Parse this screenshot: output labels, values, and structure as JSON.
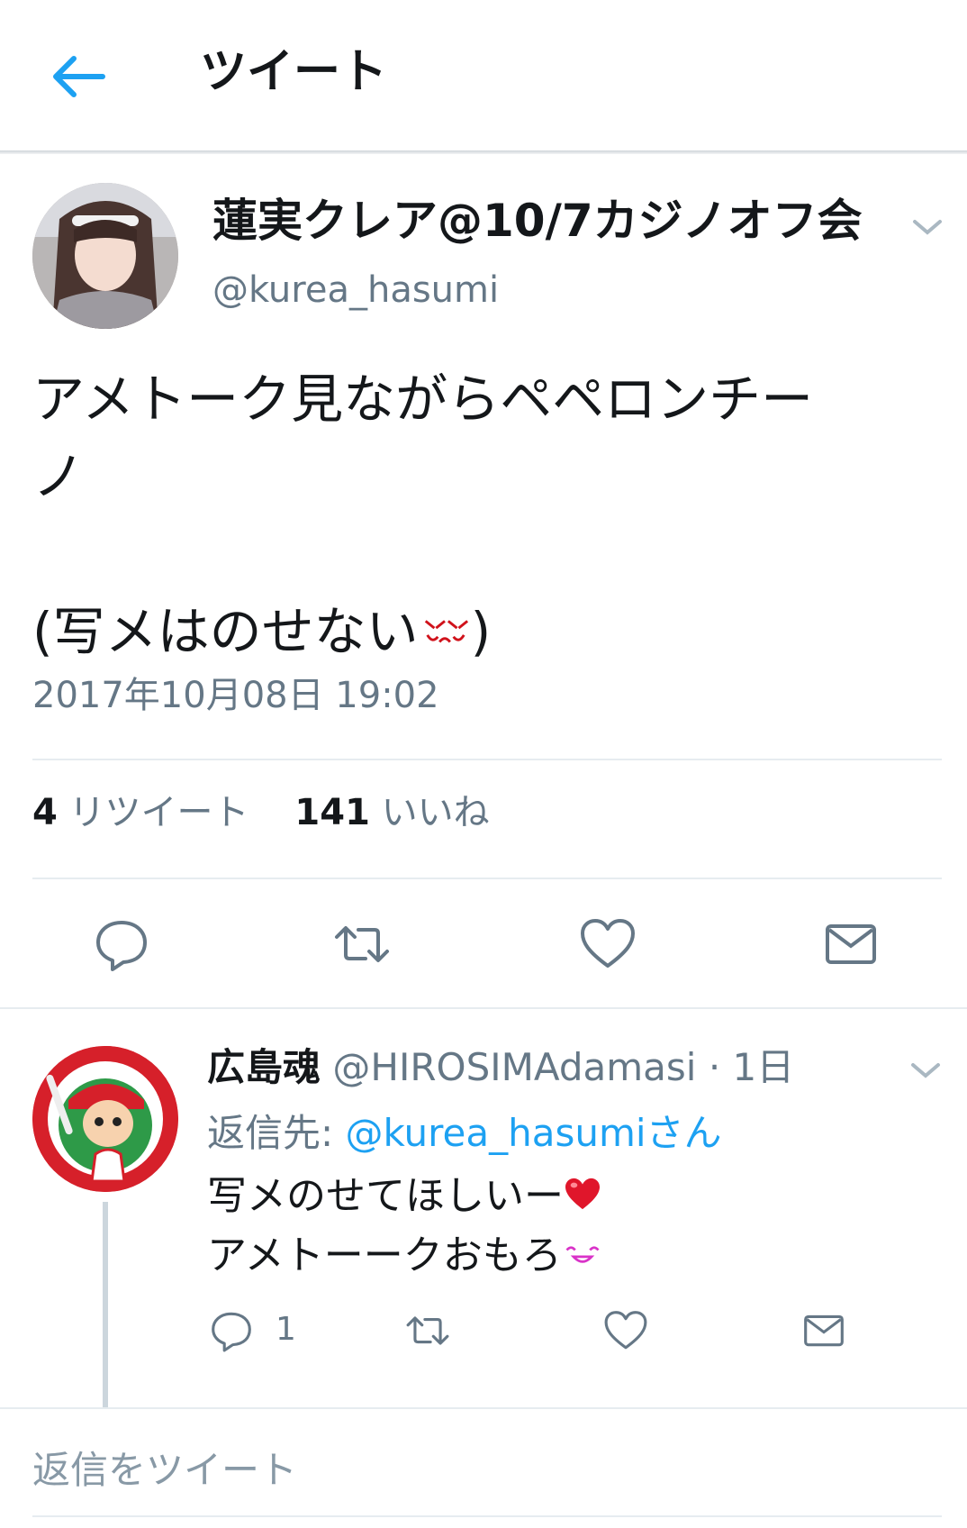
{
  "header": {
    "title": "ツイート"
  },
  "tweet": {
    "display_name": "蓮実クレア@10/7カジノオフ会",
    "handle": "@kurea_hasumi",
    "text_line1": "アメトーク見ながらペペロンチー",
    "text_line2": "ノ",
    "text_line3": "(写メはのせない",
    "text_line3_close": ")",
    "timestamp": "2017年10月08日 19:02",
    "retweet_count": "4",
    "retweet_label": "リツイート",
    "like_count": "141",
    "like_label": "いいね"
  },
  "reply": {
    "display_name": "広島魂",
    "handle": "@HIROSIMAdamasi",
    "time": "· 1日",
    "reply_to_label": "返信先: ",
    "reply_to_handle": "@kurea_hasumiさん",
    "text_line1": "写メのせてほしいー",
    "text_line2": "アメトーークおもろ",
    "reply_count": "1"
  },
  "composer": {
    "placeholder": "返信をツイート"
  },
  "colors": {
    "accent": "#1da1f2",
    "secondary_text": "#657786",
    "divider": "#e6ecf0",
    "heart_emoji": "#e0162b"
  }
}
